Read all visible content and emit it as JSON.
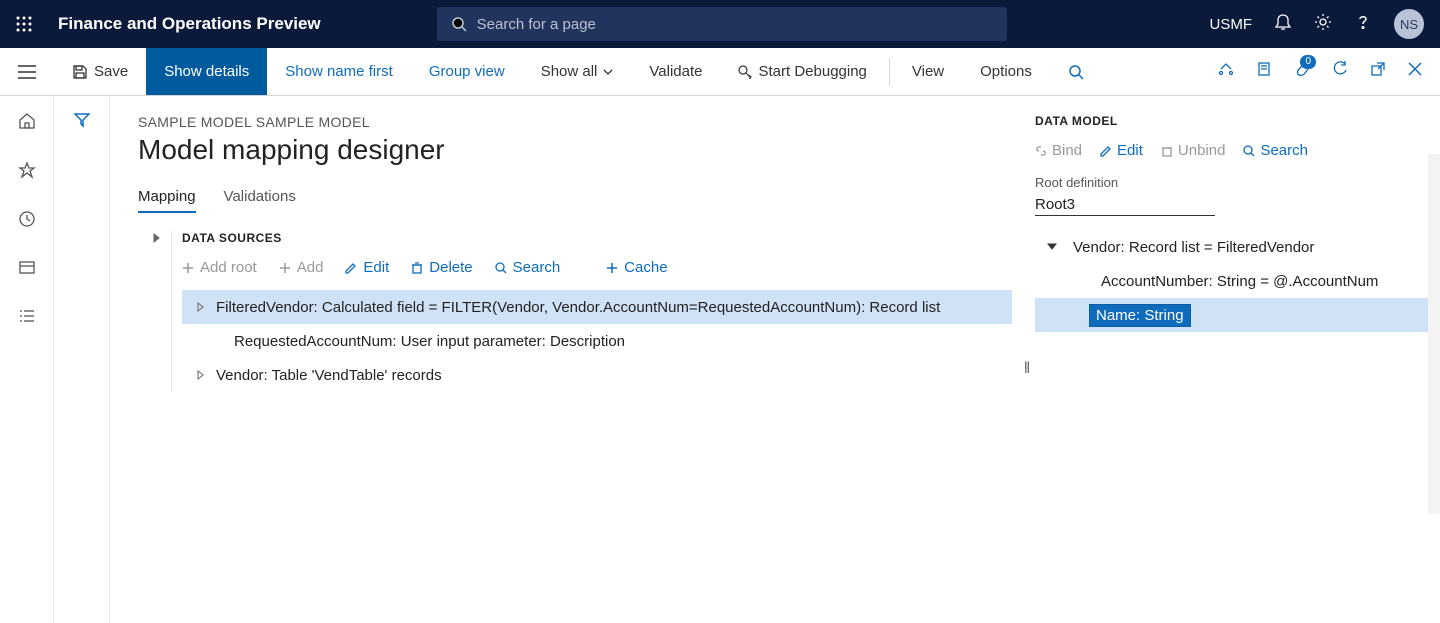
{
  "header": {
    "app_title": "Finance and Operations Preview",
    "search_placeholder": "Search for a page",
    "legal_entity": "USMF",
    "avatar": "NS"
  },
  "cmdbar": {
    "save": "Save",
    "show_details": "Show details",
    "show_name_first": "Show name first",
    "group_view": "Group view",
    "show_all": "Show all",
    "validate": "Validate",
    "start_debugging": "Start Debugging",
    "view": "View",
    "options": "Options",
    "attach_count": "0"
  },
  "page": {
    "crumb": "SAMPLE MODEL SAMPLE MODEL",
    "title": "Model mapping designer",
    "tabs": {
      "mapping": "Mapping",
      "validations": "Validations"
    }
  },
  "ds": {
    "heading": "DATA SOURCES",
    "toolbar": {
      "add_root": "Add root",
      "add": "Add",
      "edit": "Edit",
      "delete": "Delete",
      "search": "Search",
      "cache": "Cache"
    },
    "rows": {
      "r1": "FilteredVendor: Calculated field = FILTER(Vendor, Vendor.AccountNum=RequestedAccountNum): Record list",
      "r2": "RequestedAccountNum: User input parameter: Description",
      "r3": "Vendor: Table 'VendTable' records"
    }
  },
  "dm": {
    "heading": "DATA MODEL",
    "toolbar": {
      "bind": "Bind",
      "edit": "Edit",
      "unbind": "Unbind",
      "search": "Search"
    },
    "root_label": "Root definition",
    "root_value": "Root3",
    "rows": {
      "r1": "Vendor: Record list = FilteredVendor",
      "r2": "AccountNumber: String = @.AccountNum",
      "r3": "Name: String"
    }
  }
}
